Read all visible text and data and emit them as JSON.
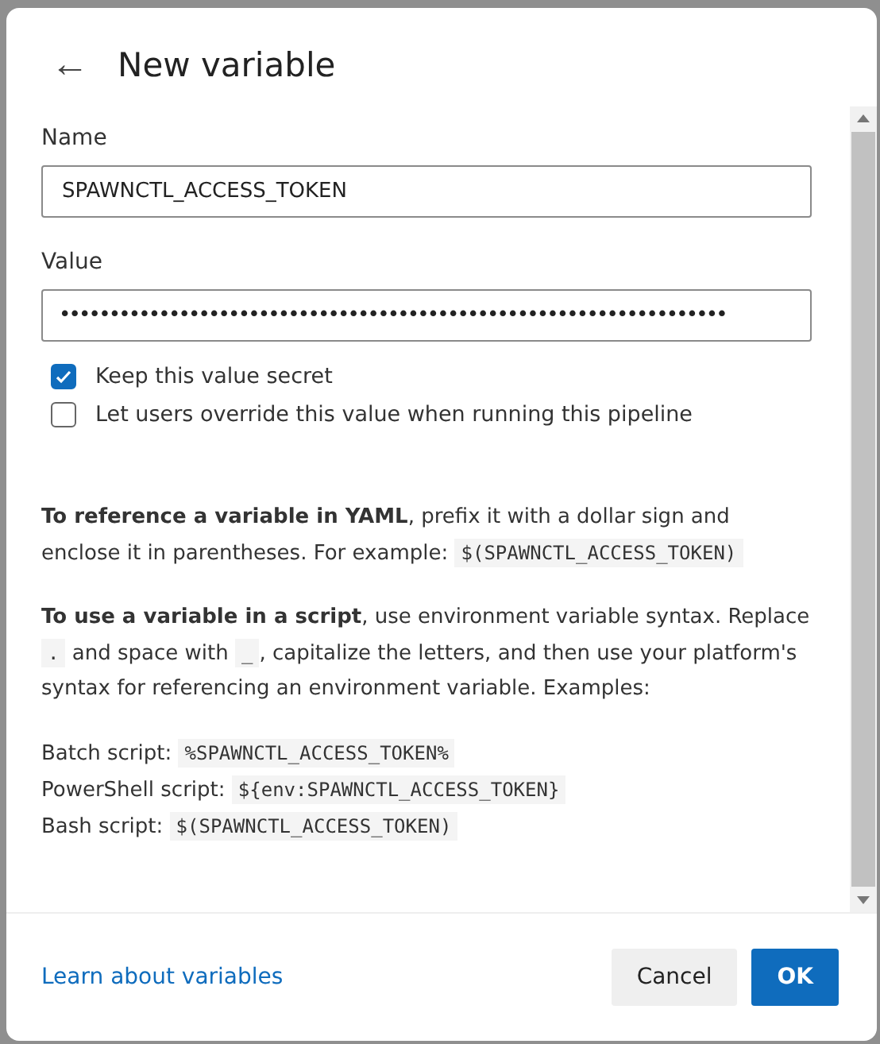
{
  "dialog": {
    "title": "New variable",
    "back_button": "←"
  },
  "fields": [
    {
      "label": "Name",
      "value": "SPAWNCTL_ACCESS_TOKEN"
    },
    {
      "label": "Value",
      "value": "•••••••••••••••••••••••••••••••••••••••••••••••••••••••••••••••••••"
    }
  ],
  "options": [
    {
      "label": "Keep this value secret",
      "checked": true
    },
    {
      "label": "Let users override this value when running this pipeline",
      "checked": false
    }
  ],
  "help": [
    [
      {
        "kind": "text",
        "text": "**To reference a variable in YAML**, prefix it with a dollar sign and enclose it in parentheses. For example: "
      },
      {
        "kind": "code",
        "text": "$(SPAWNCTL_ACCESS_TOKEN)"
      }
    ],
    [
      {
        "kind": "text",
        "text": "**To use a variable in a script**, use environment variable syntax. Replace "
      },
      {
        "kind": "code",
        "text": "."
      },
      {
        "kind": "text",
        "text": " and space with "
      },
      {
        "kind": "code",
        "text": "_"
      },
      {
        "kind": "text",
        "text": ", capitalize the letters, and then use your platform's syntax for referencing an environment variable. Examples:"
      }
    ]
  ],
  "examples": [
    {
      "label": "Batch script:",
      "code": "%SPAWNCTL_ACCESS_TOKEN%"
    },
    {
      "label": "PowerShell script:",
      "code": "${env:SPAWNCTL_ACCESS_TOKEN}"
    },
    {
      "label": "Bash script:",
      "code": "$(SPAWNCTL_ACCESS_TOKEN)"
    }
  ],
  "footer": {
    "link": "Learn about variables",
    "buttons": [
      {
        "label": "Cancel",
        "kind": "secondary"
      },
      {
        "label": "OK",
        "kind": "primary"
      }
    ]
  }
}
